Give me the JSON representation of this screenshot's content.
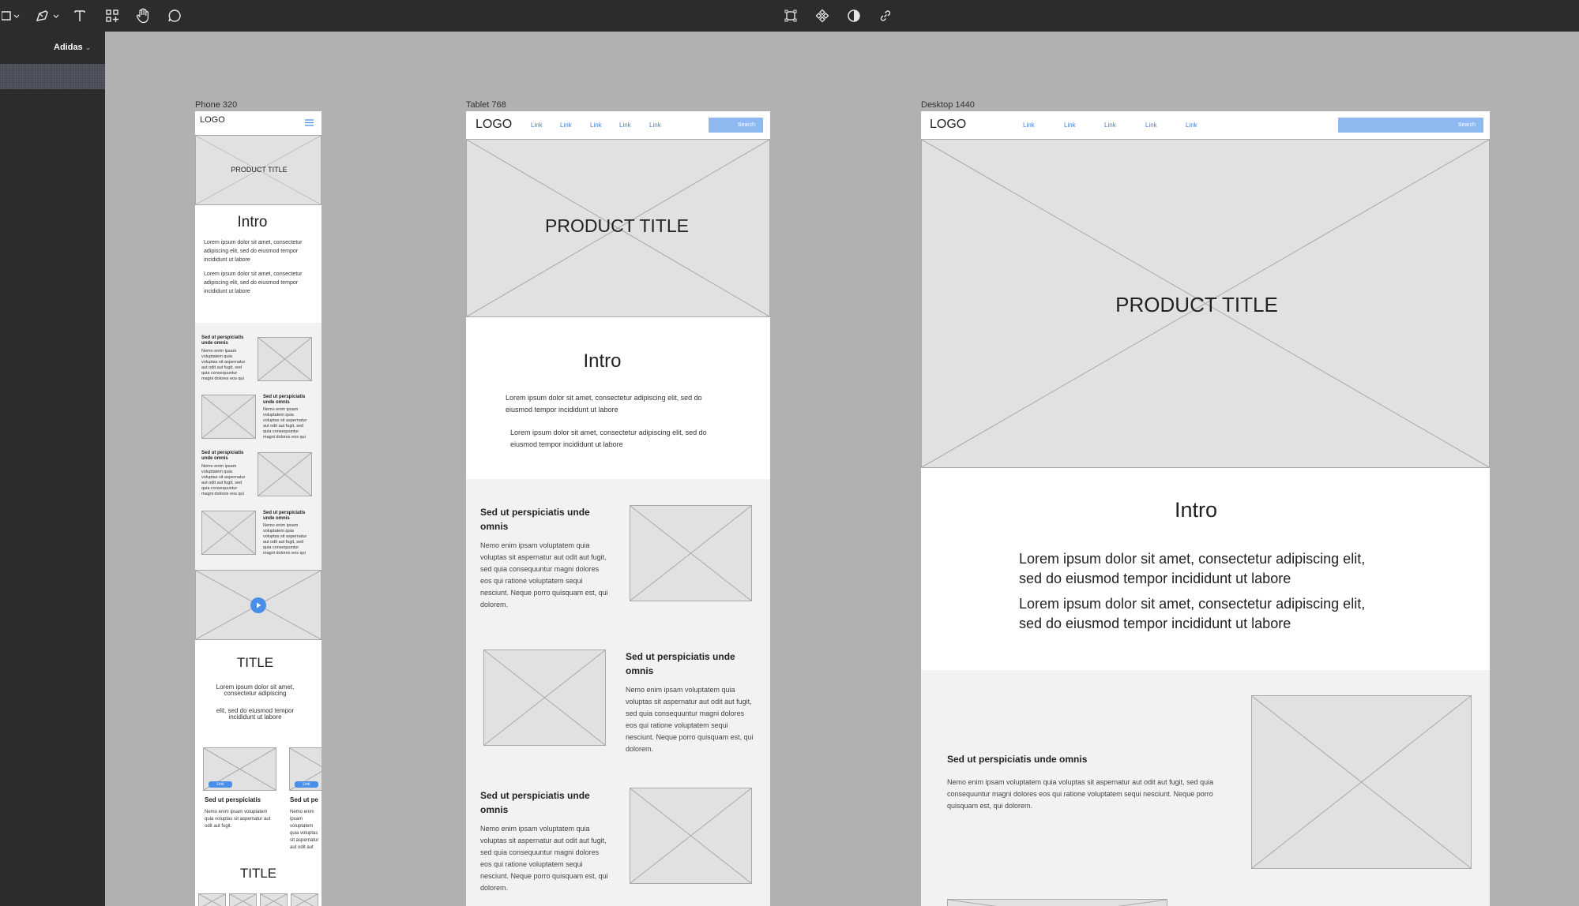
{
  "app": {
    "page_name": "Adidas"
  },
  "icons": [
    "frame-tool-icon",
    "pen-tool-icon",
    "text-tool-icon",
    "components-icon",
    "hand-tool-icon",
    "comment-tool-icon",
    "frame-selection-icon",
    "component-icon",
    "contrast-icon",
    "link-icon"
  ],
  "frames": {
    "phone": {
      "label": "Phone 320"
    },
    "tablet": {
      "label": "Tablet 768"
    },
    "desktop": {
      "label": "Desktop 1440"
    }
  },
  "common": {
    "logo": "LOGO",
    "link": "Link",
    "search": "Search",
    "product_title": "PRODUCT TITLE",
    "intro": "Intro",
    "lorem_short": "Lorem ipsum dolor sit amet, consectetur adipiscing elit, sed do eiusmod tempor incididunt ut labore",
    "feature_title": "Sed ut perspiciatis unde omnis",
    "feature_body": "Nemo enim ipsam voluptatem quia voluptas sit aspernatur aut odit aut fugit, sed quia consequuntur magni dolores eos qui ratione voluptatem sequi nesciunt. Neque porro quisquam est, qui dolorem.",
    "section_title": "TITLE",
    "card_title": "Sed ut perspiciatis",
    "card_body": "Nemo enim ipsam voluptatem quia voluptas sit aspernatur aut odit aut fugit."
  },
  "phone": {
    "title_para_1": "Lorem ipsum dolor sit amet, consectetur adipiscing",
    "title_para_2": "elit, sed do eiusmod tempor incididunt ut labore",
    "card_short_title": "Sed ut pe",
    "card_short_body": "Nemo enim ipsam voluptatem quia voluptas sit aspernatur aut odit aut fugit."
  },
  "desktop": {
    "intro_para_1": "Lorem ipsum dolor sit amet, consectetur adipiscing elit, sed do eiusmod tempor incididunt ut labore",
    "intro_para_2": "Lorem ipsum dolor sit amet, consectetur adipiscing elit, sed do eiusmod tempor incididunt ut labore"
  },
  "colors": {
    "toolbar": "#2c2c2c",
    "canvas": "#b1b1b1",
    "accent": "#4a8fe7",
    "placeholder": "#e1e1e1"
  }
}
